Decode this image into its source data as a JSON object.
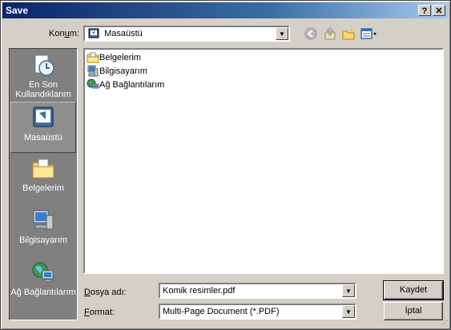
{
  "window": {
    "title": "Save",
    "help_label": "?",
    "close_label": "✕"
  },
  "lookin": {
    "label_pre": "Kon",
    "label_accel": "u",
    "label_post": "m:",
    "value": "Masaüstü"
  },
  "places": [
    {
      "label": "En Son Kullandıklarım",
      "icon": "recent-icon"
    },
    {
      "label": "Masaüstü",
      "icon": "desktop-icon"
    },
    {
      "label": "Belgelerim",
      "icon": "documents-folder-icon"
    },
    {
      "label": "Bilgisayarım",
      "icon": "computer-icon"
    },
    {
      "label": "Ağ Bağlantılarım",
      "icon": "network-icon"
    }
  ],
  "files": [
    {
      "name": "Belgelerim",
      "icon": "documents-folder-icon"
    },
    {
      "name": "Bilgisayarım",
      "icon": "computer-icon"
    },
    {
      "name": "Ağ Bağlantılarım",
      "icon": "network-icon"
    }
  ],
  "filename": {
    "label_accel": "D",
    "label_rest": "osya adı:",
    "value": "Komik resimler.pdf"
  },
  "format": {
    "label_accel": "F",
    "label_rest": "ormat:",
    "value": "Multi-Page Document (*.PDF)"
  },
  "buttons": {
    "save": "Kaydet",
    "cancel": "İptal"
  },
  "colors": {
    "title_start": "#0a246a",
    "title_end": "#a6caf0",
    "panel": "#d4d0c8",
    "places_bg": "#808080"
  }
}
